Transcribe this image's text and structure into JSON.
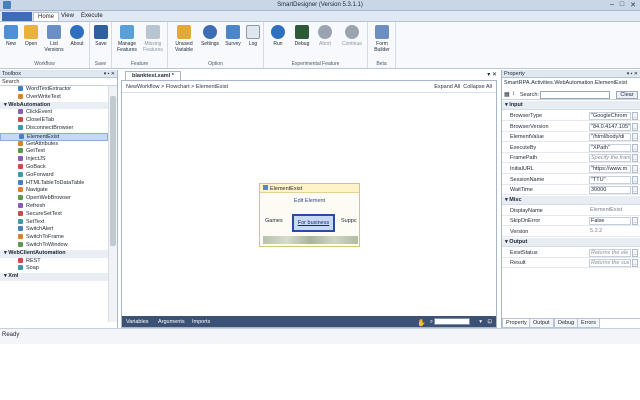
{
  "window": {
    "title": "SmartDesigner (Version 5.3.1.1)"
  },
  "ribbon_tabs": [
    "Home",
    "View",
    "Execute"
  ],
  "ribbon": {
    "workflow": {
      "label": "Workflow",
      "buttons": [
        "New",
        "Open",
        "List\nVersions",
        "About"
      ]
    },
    "save": {
      "label": "Save",
      "buttons": [
        "Save"
      ]
    },
    "feature": {
      "label": "Feature",
      "buttons": [
        "Manage\nFeatures",
        "Missing\nFeatures"
      ]
    },
    "option": {
      "label": "Option",
      "buttons": [
        "Unused\nVariable",
        "Settings",
        "Survey",
        "Log"
      ]
    },
    "experimental": {
      "label": "Experimental Feature",
      "buttons": [
        "Run",
        "Debug",
        "Abort",
        "Continue"
      ]
    },
    "beta": {
      "label": "Beta",
      "buttons": [
        "Form\nBuilder"
      ]
    }
  },
  "toolbox": {
    "title": "Toolbox",
    "search_label": "Search",
    "items": [
      {
        "type": "itm",
        "label": "WordTextExtractor"
      },
      {
        "type": "itm",
        "label": "OverWriteText"
      },
      {
        "type": "cat",
        "label": "WebAutomation"
      },
      {
        "type": "itm",
        "label": "ClickEvent"
      },
      {
        "type": "itm",
        "label": "CloseIETab"
      },
      {
        "type": "itm",
        "label": "DisconnectBrowser"
      },
      {
        "type": "itm",
        "label": "ElementExist",
        "selected": true
      },
      {
        "type": "itm",
        "label": "GetAttributes"
      },
      {
        "type": "itm",
        "label": "GetText"
      },
      {
        "type": "itm",
        "label": "InjectJS"
      },
      {
        "type": "itm",
        "label": "GoBack"
      },
      {
        "type": "itm",
        "label": "GoForward"
      },
      {
        "type": "itm",
        "label": "HTMLTableToDataTable"
      },
      {
        "type": "itm",
        "label": "Navigate"
      },
      {
        "type": "itm",
        "label": "OpenWebBrowser"
      },
      {
        "type": "itm",
        "label": "Refresh"
      },
      {
        "type": "itm",
        "label": "SecureSetText"
      },
      {
        "type": "itm",
        "label": "SetText"
      },
      {
        "type": "itm",
        "label": "SwitchAlert"
      },
      {
        "type": "itm",
        "label": "SwitchToFrame"
      },
      {
        "type": "itm",
        "label": "SwitchToWindow"
      },
      {
        "type": "cat",
        "label": "WebClientAutomation"
      },
      {
        "type": "itm",
        "label": "REST"
      },
      {
        "type": "itm",
        "label": "Soap"
      },
      {
        "type": "cat",
        "label": "Xml"
      }
    ]
  },
  "document": {
    "tab_label": "blanktest.xaml *",
    "breadcrumb": "NewWorkflow  >  Flowchart  >  ElementExist",
    "expand_all": "Expand All",
    "collapse_all": "Collapse All"
  },
  "activity": {
    "title": "ElementExist",
    "edit_label": "Edit Element",
    "tabs": [
      "Games",
      "For business",
      "Suppc"
    ],
    "selected_tab": "For business"
  },
  "designer_footer": {
    "variables": "Variables",
    "arguments": "Arguments",
    "imports": "Imports"
  },
  "properties": {
    "title": "Property",
    "info": "SmartRPA.Activities.WebAutomation.ElementExist",
    "search_label": "Search:",
    "clear": "Clear",
    "sections": [
      {
        "name": "Input",
        "rows": [
          {
            "name": "BrowserType",
            "value": "\"GoogleChrom"
          },
          {
            "name": "BrowserVersion",
            "value": "\"84.0.4147.105\""
          },
          {
            "name": "ElementValue",
            "value": "\"/html/body/di"
          },
          {
            "name": "ExecuteBy",
            "value": "\"XPath\""
          },
          {
            "name": "FramePath",
            "value": "Specify the fram",
            "placeholder": true
          },
          {
            "name": "InitialURL",
            "value": "\"https://www.m"
          },
          {
            "name": "SessionName",
            "value": "\"TTU\""
          },
          {
            "name": "WaitTime",
            "value": "30000"
          }
        ]
      },
      {
        "name": "Misc",
        "rows": [
          {
            "name": "DisplayName",
            "value": "ElementExist",
            "readonly": true
          },
          {
            "name": "SkipOnError",
            "value": "False"
          },
          {
            "name": "Version",
            "value": "5.2.2",
            "readonly": true
          }
        ]
      },
      {
        "name": "Output",
        "rows": [
          {
            "name": "ExistStatus",
            "value": "Returns the ele",
            "placeholder": true
          },
          {
            "name": "Result",
            "value": "Returns the sus",
            "placeholder": true
          }
        ]
      }
    ],
    "tabs": [
      "Property",
      "Output",
      "Debug",
      "Errors"
    ]
  },
  "status": {
    "text": "Ready"
  }
}
